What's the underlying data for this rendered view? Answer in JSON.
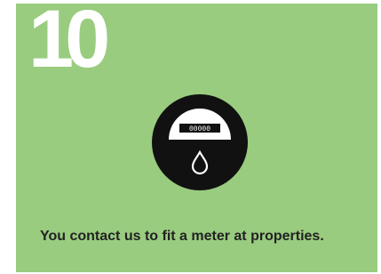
{
  "card": {
    "step_number": "10",
    "caption": "You contact us to fit a meter at properties.",
    "background_color": "#99cc7f"
  },
  "meter_icon": {
    "icon": "water-meter-icon",
    "dial_reading": "00000"
  }
}
